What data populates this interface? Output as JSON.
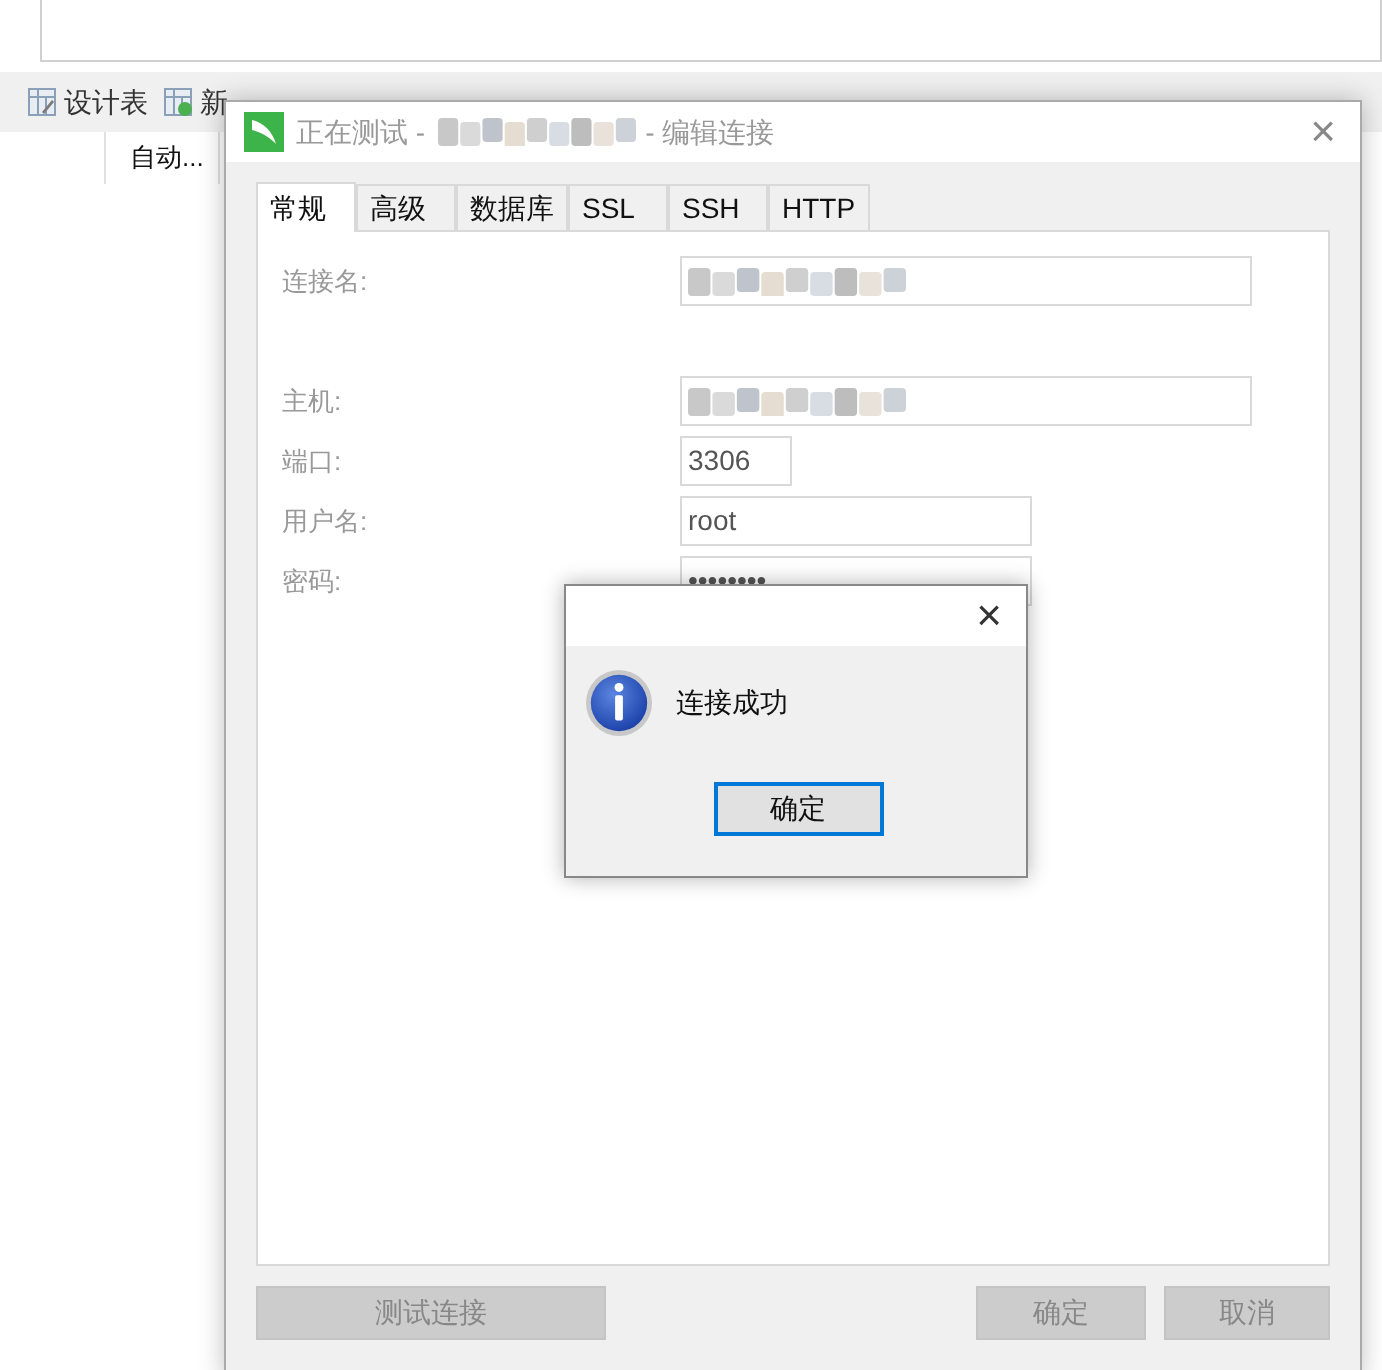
{
  "background": {
    "toolbar": [
      {
        "label": "设计表"
      },
      {
        "label": "新"
      }
    ],
    "column_header": "自动..."
  },
  "dialog": {
    "title_prefix": "正在测试 -",
    "title_suffix": "- 编辑连接",
    "close": "×",
    "tabs": [
      {
        "label": "常规",
        "selected": true
      },
      {
        "label": "高级",
        "selected": false
      },
      {
        "label": "数据库",
        "selected": false
      },
      {
        "label": "SSL",
        "selected": false
      },
      {
        "label": "SSH",
        "selected": false
      },
      {
        "label": "HTTP",
        "selected": false
      }
    ],
    "fields": [
      {
        "label": "连接名:",
        "kind": "blurred"
      },
      {
        "label": "主机:",
        "kind": "blurred"
      },
      {
        "label": "端口:",
        "kind": "text",
        "value": "3306"
      },
      {
        "label": "用户名:",
        "kind": "text",
        "value": "root"
      },
      {
        "label": "密码:",
        "kind": "text",
        "value": "••••••••"
      }
    ],
    "buttons": {
      "test": {
        "label": "测试连接",
        "disabled": true
      },
      "ok": {
        "label": "确定",
        "disabled": true
      },
      "cancel": {
        "label": "取消",
        "disabled": true
      }
    }
  },
  "message_box": {
    "close": "×",
    "message": "连接成功",
    "button": "确定"
  }
}
